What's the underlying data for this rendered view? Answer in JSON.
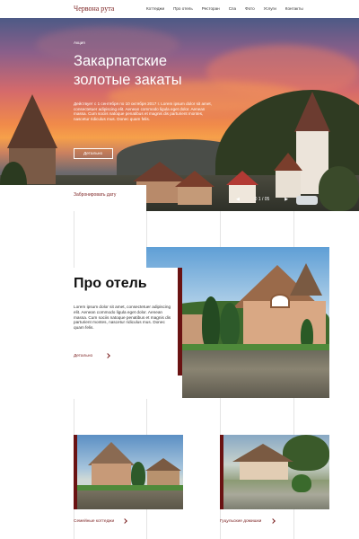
{
  "header": {
    "logo": "Червона рута",
    "nav": [
      "Коттеджи",
      "Про отель",
      "Ресторан",
      "Спа",
      "Фото",
      "Услуги",
      "Контакты"
    ]
  },
  "hero": {
    "tag": "Акция",
    "title_line1": "Закарпатские",
    "title_line2": "золотые закаты",
    "text": "Действует с 1 сентября по 10 октября 2017 г. Lorem ipsum dolor sit amet, consectetuer adipiscing elit. Aenean commodo ligula eget dolor. Aenean massa. Cum sociis natoque penatibus et magnis dis parturient montes, nascetur ridiculus mus. Donec quam felis.",
    "button": "Детально",
    "slider_counter": "0 1 / 05",
    "prev": "◀",
    "next": "▶",
    "book_link": "Забронировать дату"
  },
  "about": {
    "title": "Про отель",
    "text": "Lorem ipsum dolor sit amet, consectetuer adipiscing elit. Aenean commodo ligula eget dolor. Aenean massa. Cum sociis natoque penatibus et magnis dis parturient montes, nascetur ridiculus mus. Donec quam felis.",
    "link": "Детально"
  },
  "cards": [
    {
      "label": "Семейные коттеджи"
    },
    {
      "label": "Гуцульские домишки"
    }
  ],
  "colors": {
    "accent": "#6a1212",
    "link": "#7a1f1f"
  },
  "icons": {
    "arrow": "chevron-right-icon"
  }
}
